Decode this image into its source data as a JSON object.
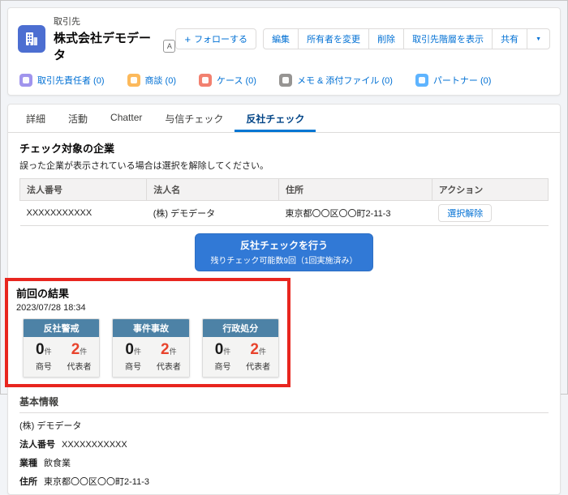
{
  "colors": {
    "accent_blue": "#0176d3",
    "active_tab_text": "#014486",
    "cta_blue": "#3179d6",
    "annotation_red": "#e8261f",
    "result_card_header": "#4d82a6",
    "count_red": "#e8432c",
    "account_icon": "#4c6ed1",
    "icon_contact": "#a094ed",
    "icon_opportunity": "#fcb95b",
    "icon_case": "#f2806f",
    "icon_notes": "#969492",
    "icon_partner": "#5eb4ff"
  },
  "header": {
    "entity_label": "取引先",
    "title": "株式会社デモデータ",
    "title_badge": "A",
    "follow_icon": "+",
    "follow_button": "フォローする",
    "action_buttons": [
      "編集",
      "所有者を変更",
      "削除",
      "取引先階層を表示",
      "共有"
    ],
    "more_icon": "▼"
  },
  "related_links": [
    {
      "label": "取引先責任者 (0)"
    },
    {
      "label": "商談 (0)"
    },
    {
      "label": "ケース (0)"
    },
    {
      "label": "メモ & 添付ファイル (0)"
    },
    {
      "label": "パートナー (0)"
    }
  ],
  "tabs": [
    {
      "label": "詳細"
    },
    {
      "label": "活動"
    },
    {
      "label": "Chatter"
    },
    {
      "label": "与信チェック"
    },
    {
      "label": "反社チェック"
    }
  ],
  "check_section": {
    "heading": "チェック対象の企業",
    "note": "誤った企業が表示されている場合は選択を解除してください。",
    "table": {
      "headers": [
        "法人番号",
        "法人名",
        "住所",
        "アクション"
      ],
      "row": {
        "corp_number": "XXXXXXXXXXX",
        "name": "(株) デモデータ",
        "address": "東京都〇〇区〇〇町2-11-3",
        "action": "選択解除"
      }
    },
    "cta": {
      "label": "反社チェックを行う",
      "sublabel": "残りチェック可能数9回（1回実施済み）"
    }
  },
  "results": {
    "heading": "前回の結果",
    "timestamp": "2023/07/28 18:34",
    "cards": [
      {
        "title": "反社警戒",
        "items": [
          {
            "count": "0",
            "unit": "件",
            "label": "商号"
          },
          {
            "count": "2",
            "unit": "件",
            "label": "代表者"
          }
        ]
      },
      {
        "title": "事件事故",
        "items": [
          {
            "count": "0",
            "unit": "件",
            "label": "商号"
          },
          {
            "count": "2",
            "unit": "件",
            "label": "代表者"
          }
        ]
      },
      {
        "title": "行政処分",
        "items": [
          {
            "count": "0",
            "unit": "件",
            "label": "商号"
          },
          {
            "count": "2",
            "unit": "件",
            "label": "代表者"
          }
        ]
      }
    ]
  },
  "basic_info": {
    "heading": "基本情報",
    "company": "(株) デモデータ",
    "fields": [
      {
        "label": "法人番号",
        "value": "XXXXXXXXXXX"
      },
      {
        "label": "業種",
        "value": "飲食業"
      },
      {
        "label": "住所",
        "value": "東京都〇〇区〇〇町2-11-3"
      }
    ]
  }
}
